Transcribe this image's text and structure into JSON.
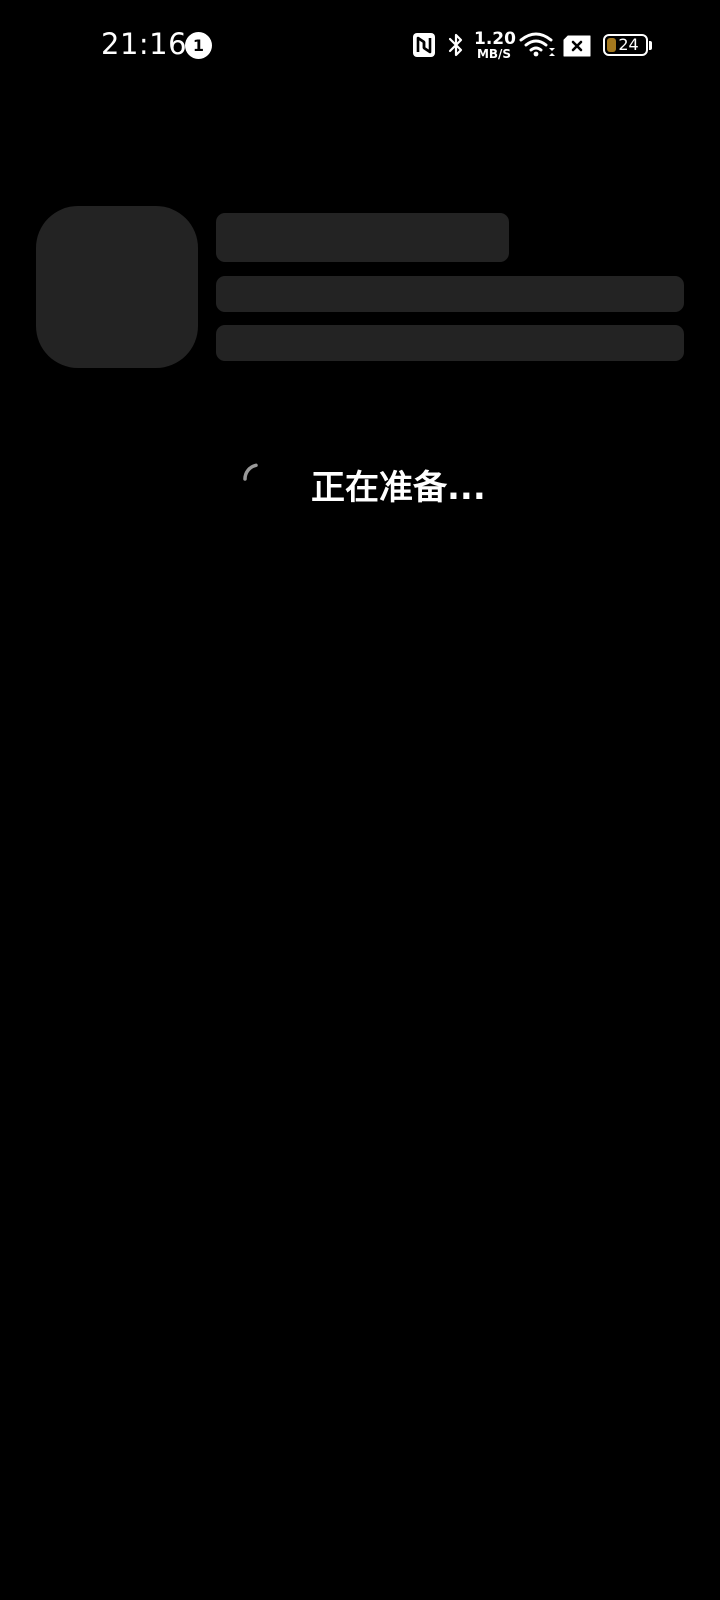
{
  "status_bar": {
    "time": "21:16",
    "notification_count": "1",
    "net_speed_value": "1.20",
    "net_speed_unit": "MB/S",
    "battery_level": "24",
    "battery_fraction": 0.24,
    "icons": [
      "nfc-icon",
      "bluetooth-icon",
      "wifi-icon",
      "sim-no-signal-icon",
      "battery-icon"
    ],
    "battery_color": "#a4781e"
  },
  "loading": {
    "text": "正在准备..."
  },
  "colors": {
    "background": "#000000",
    "skeleton": "#232323",
    "text": "#ffffff"
  }
}
